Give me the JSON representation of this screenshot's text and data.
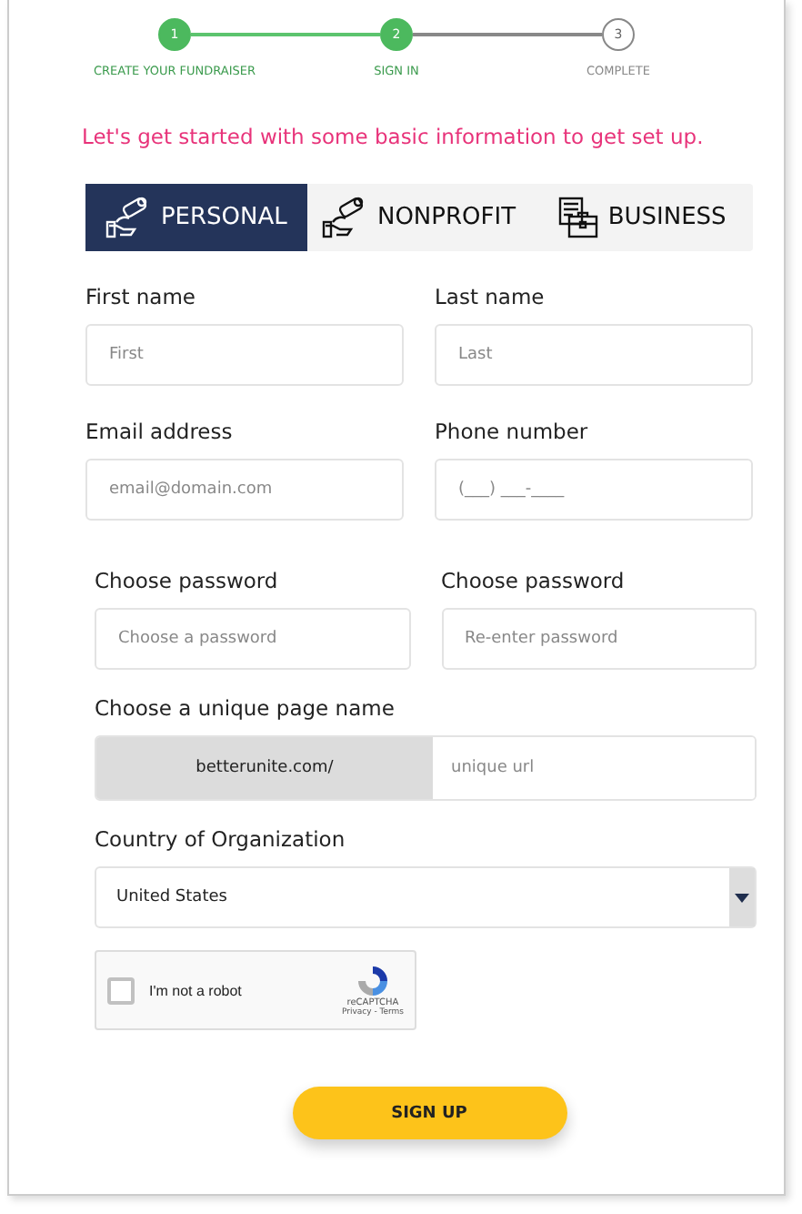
{
  "steps": [
    {
      "number": "1",
      "label": "CREATE YOUR FUNDRAISER",
      "done": true
    },
    {
      "number": "2",
      "label": "SIGN IN",
      "done": true
    },
    {
      "number": "3",
      "label": "COMPLETE",
      "done": false
    }
  ],
  "intro": "Let's get started with some basic information to get set up.",
  "tabs": [
    {
      "label": "PERSONAL",
      "kind": "hand",
      "selected": true
    },
    {
      "label": "NONPROFIT",
      "kind": "hand",
      "selected": false
    },
    {
      "label": "BUSINESS",
      "kind": "briefcase",
      "selected": false
    }
  ],
  "rows": [
    [
      {
        "label": "First name",
        "placeholder": "First"
      },
      {
        "label": "Last name",
        "placeholder": "Last"
      }
    ],
    [
      {
        "label": "Email address",
        "placeholder": "email@domain.com"
      },
      {
        "label": "Phone number",
        "placeholder": "(___) ___-____"
      }
    ]
  ],
  "passwords": [
    {
      "label": "Choose password",
      "placeholder": "Choose a password"
    },
    {
      "label": "Choose password",
      "placeholder": "Re-enter password"
    }
  ],
  "page_name": {
    "label": "Choose a unique page name",
    "prefix": "betterunite.com/",
    "placeholder": "unique url"
  },
  "country": {
    "label": "Country of Organization",
    "value": "United States"
  },
  "captcha": {
    "label": "I'm not a robot",
    "checked": false,
    "brand": "reCAPTCHA",
    "links": "Privacy - Terms"
  },
  "submit": "SIGN UP"
}
